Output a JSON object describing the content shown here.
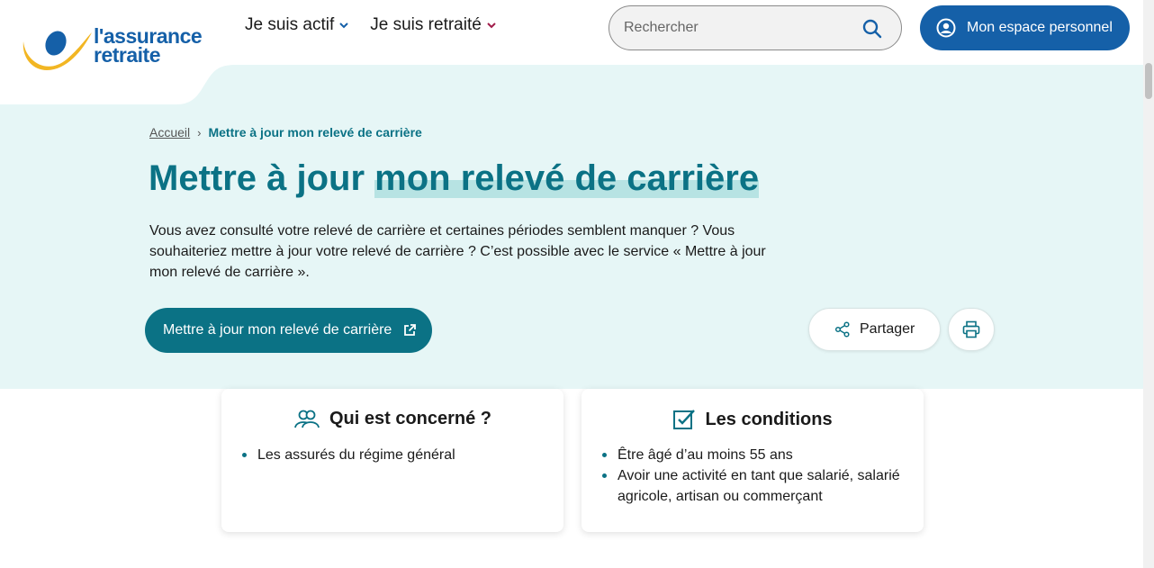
{
  "header": {
    "logo_line1": "l'assurance",
    "logo_line2": "retraite",
    "nav": [
      {
        "label": "Je suis actif"
      },
      {
        "label": "Je suis retraité"
      }
    ],
    "search_placeholder": "Rechercher",
    "account_label": "Mon espace personnel"
  },
  "breadcrumb": {
    "home": "Accueil",
    "current": "Mettre à jour mon relevé de carrière"
  },
  "hero": {
    "title_part1": "Mettre à jour",
    "title_part2": "mon relevé de carrière",
    "intro": "Vous avez consulté votre relevé de carrière et certaines périodes semblent manquer ? Vous souhaiteriez mettre à jour votre relevé de carrière ? C’est possible avec le service « Mettre à jour mon relevé de carrière ».",
    "cta_label": "Mettre à jour mon relevé de carrière",
    "share_label": "Partager"
  },
  "cards": [
    {
      "title": "Qui est concerné ?",
      "items": [
        "Les assurés du régime général"
      ]
    },
    {
      "title": "Les conditions",
      "items": [
        "Être âgé d’au moins 55 ans",
        "Avoir une activité en tant que salarié, salarié agricole, artisan ou commerçant"
      ]
    }
  ],
  "colors": {
    "brand_blue": "#1560a8",
    "teal": "#0b7285",
    "hero_bg": "#e6f6f6",
    "logo_yellow": "#f2b623"
  }
}
